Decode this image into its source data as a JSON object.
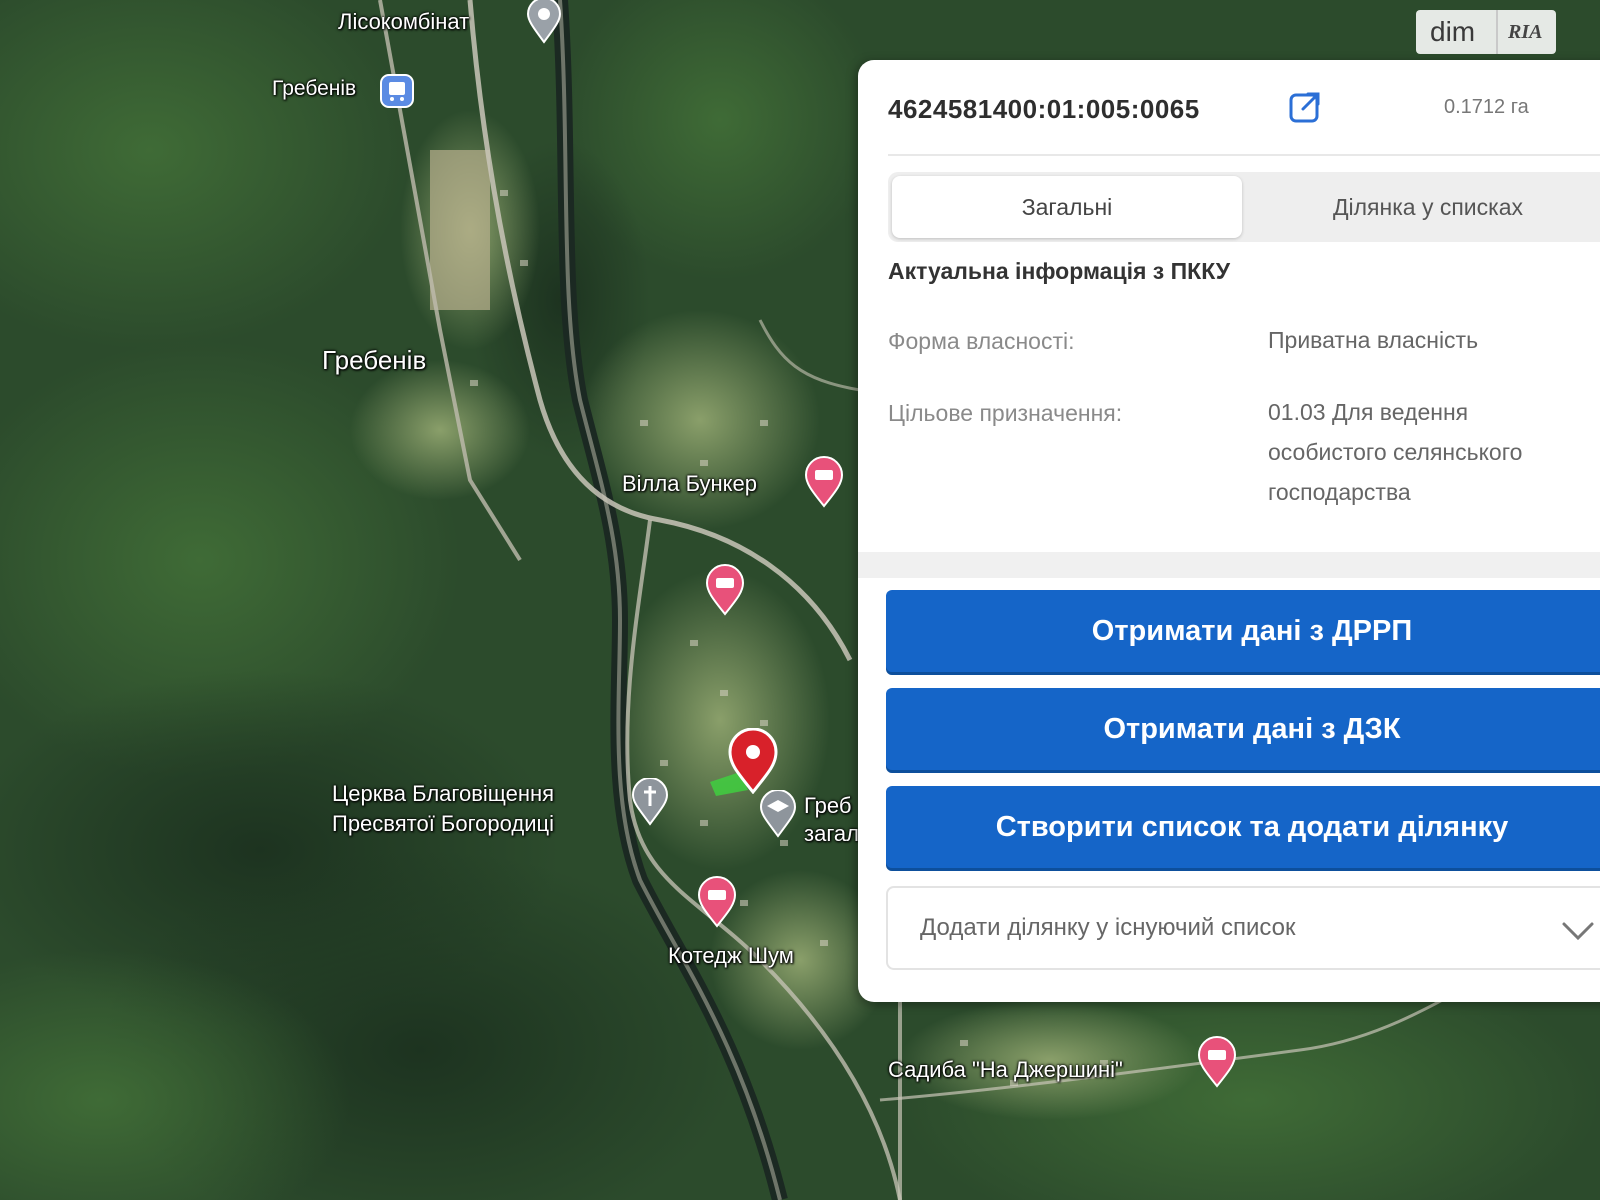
{
  "watermark": {
    "left": "dim",
    "right": "RIA"
  },
  "map": {
    "labels": {
      "lisokombinat": "Лісокомбінат",
      "hrebeniv_station": "Гребенів",
      "hrebeniv_village": "Гребенів",
      "villa": "Вілла Бункер",
      "church_line1": "Церква Благовіщення",
      "church_line2": "Пресвятої Богородиці",
      "cemetery_line1": "Греб",
      "cemetery_line2": "загал",
      "cottage": "Котедж Шум",
      "sadyba": "Садиба \"На Джершині\""
    },
    "colors": {
      "poi_pin": "#e8517a",
      "selected_pin": "#d8212a",
      "parcel": "#3fcf3f"
    }
  },
  "panel": {
    "cadastral_number": "4624581400:01:005:0065",
    "area": "0.1712 га",
    "tabs": [
      "Загальні",
      "Ділянка у списках"
    ],
    "section_title": "Актуальна інформація з ПККУ",
    "ownership_label": "Форма власності:",
    "ownership_value": "Приватна власність",
    "purpose_label": "Цільове призначення:",
    "purpose_line1": "01.03 Для ведення",
    "purpose_line2": "особистого селянського",
    "purpose_line3": "господарства",
    "buttons": [
      "Отримати дані з ДРРП",
      "Отримати дані з ДЗК",
      "Створити список та додати ділянку"
    ],
    "select_placeholder": "Додати ділянку у існуючий список",
    "icons": [
      "external-link-icon",
      "close-icon",
      "chevron-down-icon"
    ],
    "accent_color": "#1565c8"
  }
}
